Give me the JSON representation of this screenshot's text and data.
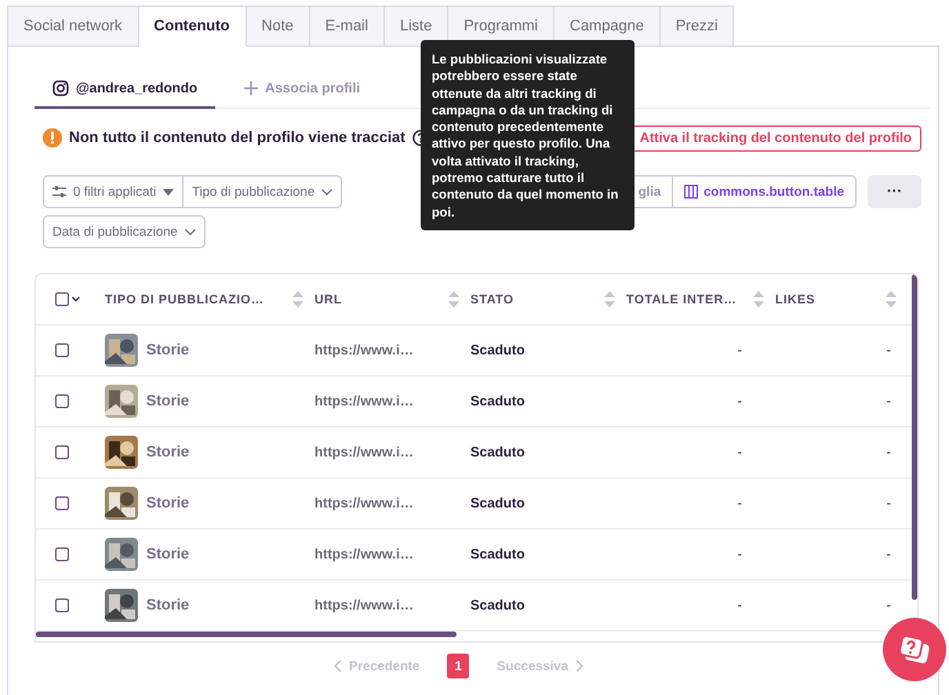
{
  "tabs": [
    {
      "label": "Social network",
      "selected": false
    },
    {
      "label": "Contenuto",
      "selected": true
    },
    {
      "label": "Note",
      "selected": false
    },
    {
      "label": "E-mail",
      "selected": false
    },
    {
      "label": "Liste",
      "selected": false
    },
    {
      "label": "Programmi",
      "selected": false
    },
    {
      "label": "Campagne",
      "selected": false
    },
    {
      "label": "Prezzi",
      "selected": false
    }
  ],
  "profile_tabs": [
    {
      "label": "@andrea_redondo",
      "selected": true,
      "kind": "instagram"
    },
    {
      "label": "Associa profili",
      "selected": false,
      "kind": "add"
    }
  ],
  "warning": {
    "text": "Non tutto il contenuto del profilo viene tracciat",
    "action": "Attiva il tracking del contenuto del profilo"
  },
  "tooltip": "Le pubblicazioni visualizzate potrebbero essere state ottenute da altri tracking di campagna o da un tracking di contenuto precedentemente attivo per questo profilo. Una volta attivato il tracking, potremo catturare tutto il contenuto da quel momento in poi.",
  "filters": [
    {
      "label": "0 filtri applicati",
      "kind": "filter"
    },
    {
      "label": "Tipo di pubblicazione",
      "kind": "dropdown"
    },
    {
      "label": "Data di pubblicazione",
      "kind": "dropdown"
    }
  ],
  "view_buttons": [
    {
      "label": "glia",
      "selected": false
    },
    {
      "label": "commons.button.table",
      "selected": true
    }
  ],
  "more_button": "···",
  "table": {
    "select_all": {
      "checked": false
    },
    "columns": [
      "TIPO DI PUBBLICAZIO…",
      "URL",
      "STATO",
      "TOTALE INTER…",
      "LIKES"
    ],
    "rows": [
      {
        "checked": false,
        "type": "Storie",
        "url": "https://www.i…",
        "status": "Scaduto",
        "total": "-",
        "likes": "-"
      },
      {
        "checked": false,
        "type": "Storie",
        "url": "https://www.i…",
        "status": "Scaduto",
        "total": "-",
        "likes": "-"
      },
      {
        "checked": false,
        "type": "Storie",
        "url": "https://www.i…",
        "status": "Scaduto",
        "total": "-",
        "likes": "-"
      },
      {
        "checked": false,
        "type": "Storie",
        "url": "https://www.i…",
        "status": "Scaduto",
        "total": "-",
        "likes": "-"
      },
      {
        "checked": false,
        "type": "Storie",
        "url": "https://www.i…",
        "status": "Scaduto",
        "total": "-",
        "likes": "-"
      },
      {
        "checked": false,
        "type": "Storie",
        "url": "https://www.i…",
        "status": "Scaduto",
        "total": "-",
        "likes": "-"
      }
    ]
  },
  "pagination": {
    "previous": "Precedente",
    "pages": [
      {
        "label": "1",
        "selected": true
      }
    ],
    "next": "Successiva"
  }
}
